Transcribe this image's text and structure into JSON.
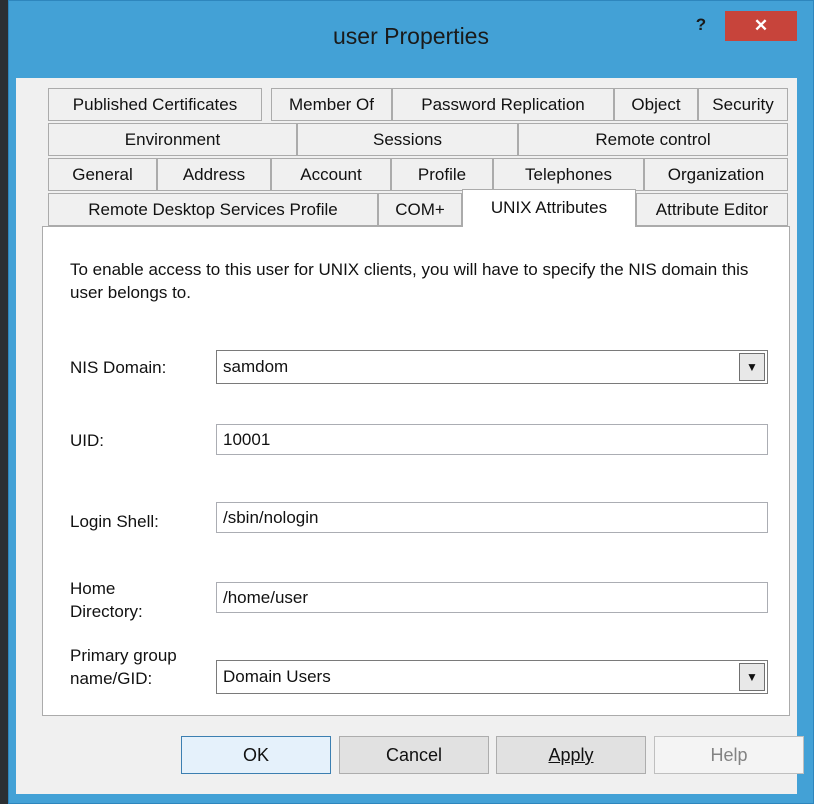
{
  "window": {
    "title": "user Properties",
    "help_label": "?",
    "close_label": "✕"
  },
  "tabs": {
    "row1": [
      "Published Certificates",
      "Member Of",
      "Password Replication",
      "Object",
      "Security"
    ],
    "row2": [
      "Environment",
      "Sessions",
      "Remote control"
    ],
    "row3": [
      "General",
      "Address",
      "Account",
      "Profile",
      "Telephones",
      "Organization"
    ],
    "row4": [
      "Remote Desktop Services Profile",
      "COM+",
      "UNIX Attributes",
      "Attribute Editor"
    ],
    "active": "UNIX Attributes"
  },
  "panel": {
    "intro": "To enable access to this user for UNIX clients, you will have to specify the NIS domain this user belongs to.",
    "nis_domain": {
      "label": "NIS Domain:",
      "value": "samdom"
    },
    "uid": {
      "label": "UID:",
      "value": "10001"
    },
    "login_shell": {
      "label": "Login Shell:",
      "value": "/sbin/nologin"
    },
    "home_directory": {
      "label_line1": "Home",
      "label_line2": "Directory:",
      "value": "/home/user"
    },
    "primary_group": {
      "label_line1": "Primary group",
      "label_line2": "name/GID:",
      "value": "Domain Users"
    }
  },
  "buttons": {
    "ok": "OK",
    "cancel": "Cancel",
    "apply": "Apply",
    "help": "Help"
  },
  "colors": {
    "titlebar": "#43a1d6",
    "close_button": "#c7443b",
    "dialog_background": "#f0f0f0"
  }
}
